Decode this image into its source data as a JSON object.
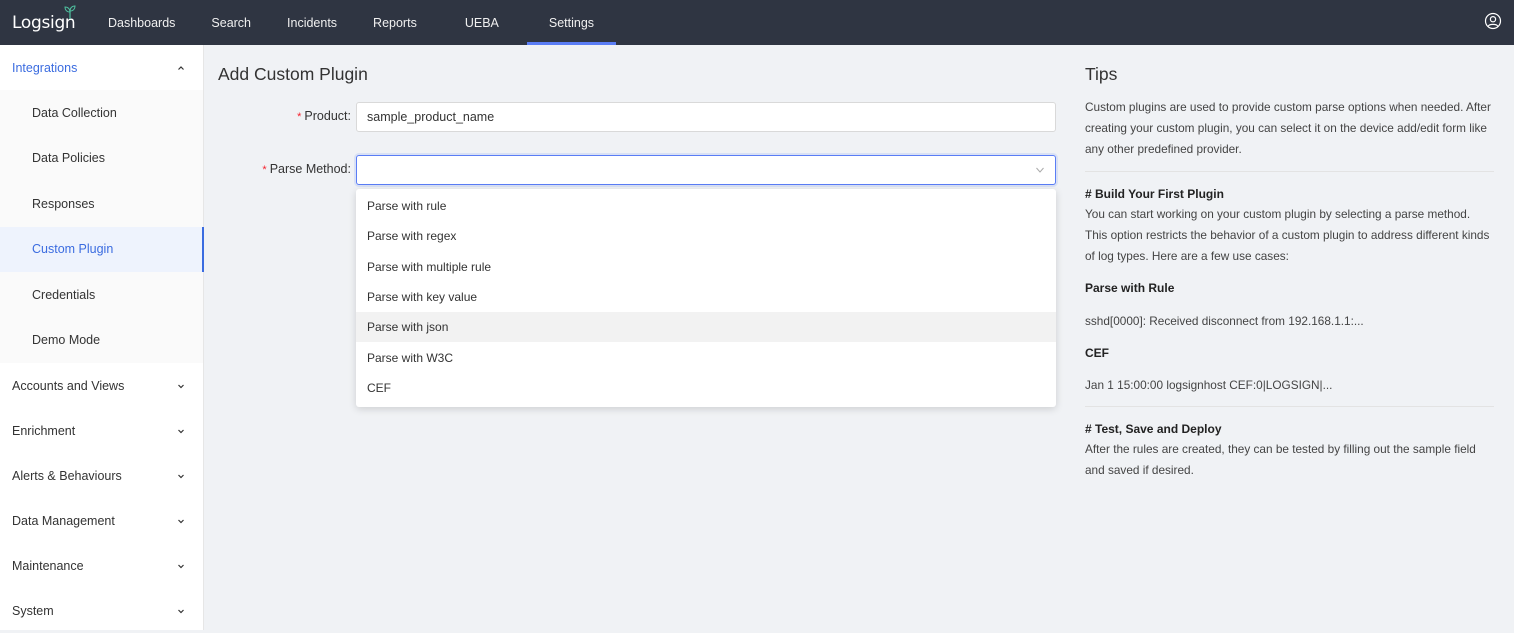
{
  "brand": {
    "name": "Logsign"
  },
  "nav": {
    "items": [
      {
        "label": "Dashboards"
      },
      {
        "label": "Search"
      },
      {
        "label": "Incidents"
      },
      {
        "label": "Reports"
      },
      {
        "label": "UEBA"
      },
      {
        "label": "Settings",
        "active": true
      }
    ]
  },
  "sidebar": {
    "integrations": {
      "label": "Integrations",
      "items": [
        {
          "label": "Data Collection"
        },
        {
          "label": "Data Policies"
        },
        {
          "label": "Responses"
        },
        {
          "label": "Custom Plugin",
          "active": true
        },
        {
          "label": "Credentials"
        },
        {
          "label": "Demo Mode"
        }
      ]
    },
    "groups": [
      {
        "label": "Accounts and Views"
      },
      {
        "label": "Enrichment"
      },
      {
        "label": "Alerts & Behaviours"
      },
      {
        "label": "Data Management"
      },
      {
        "label": "Maintenance"
      },
      {
        "label": "System"
      }
    ]
  },
  "main": {
    "title": "Add Custom Plugin",
    "product": {
      "label": "Product",
      "value": "sample_product_name"
    },
    "parse_method": {
      "label": "Parse Method",
      "value": "",
      "options": [
        "Parse with rule",
        "Parse with regex",
        "Parse with multiple rule",
        "Parse with key value",
        "Parse with json",
        "Parse with W3C",
        "CEF"
      ],
      "hovered": "Parse with json"
    }
  },
  "tips": {
    "title": "Tips",
    "intro": "Custom plugins are used to provide custom parse options when needed. After creating your custom plugin, you can select it on the device add/edit form like any other predefined provider.",
    "build_heading": "# Build Your First Plugin",
    "build_text": "You can start working on your custom plugin by selecting a parse method. This option restricts the behavior of a custom plugin to address different kinds of log types. Here are a few use cases:",
    "rule_heading": "Parse with Rule",
    "rule_example": "sshd[0000]: Received disconnect from 192.168.1.1:...",
    "cef_heading": "CEF",
    "cef_example": "Jan 1 15:00:00 logsignhost CEF:0|LOGSIGN|...",
    "deploy_heading": "# Test, Save and Deploy",
    "deploy_text": "After the rules are created, they can be tested by filling out the sample field and saved if desired."
  },
  "colors": {
    "topbar": "#2f3542",
    "accent": "#3b6ce0",
    "required": "#f5222d"
  }
}
